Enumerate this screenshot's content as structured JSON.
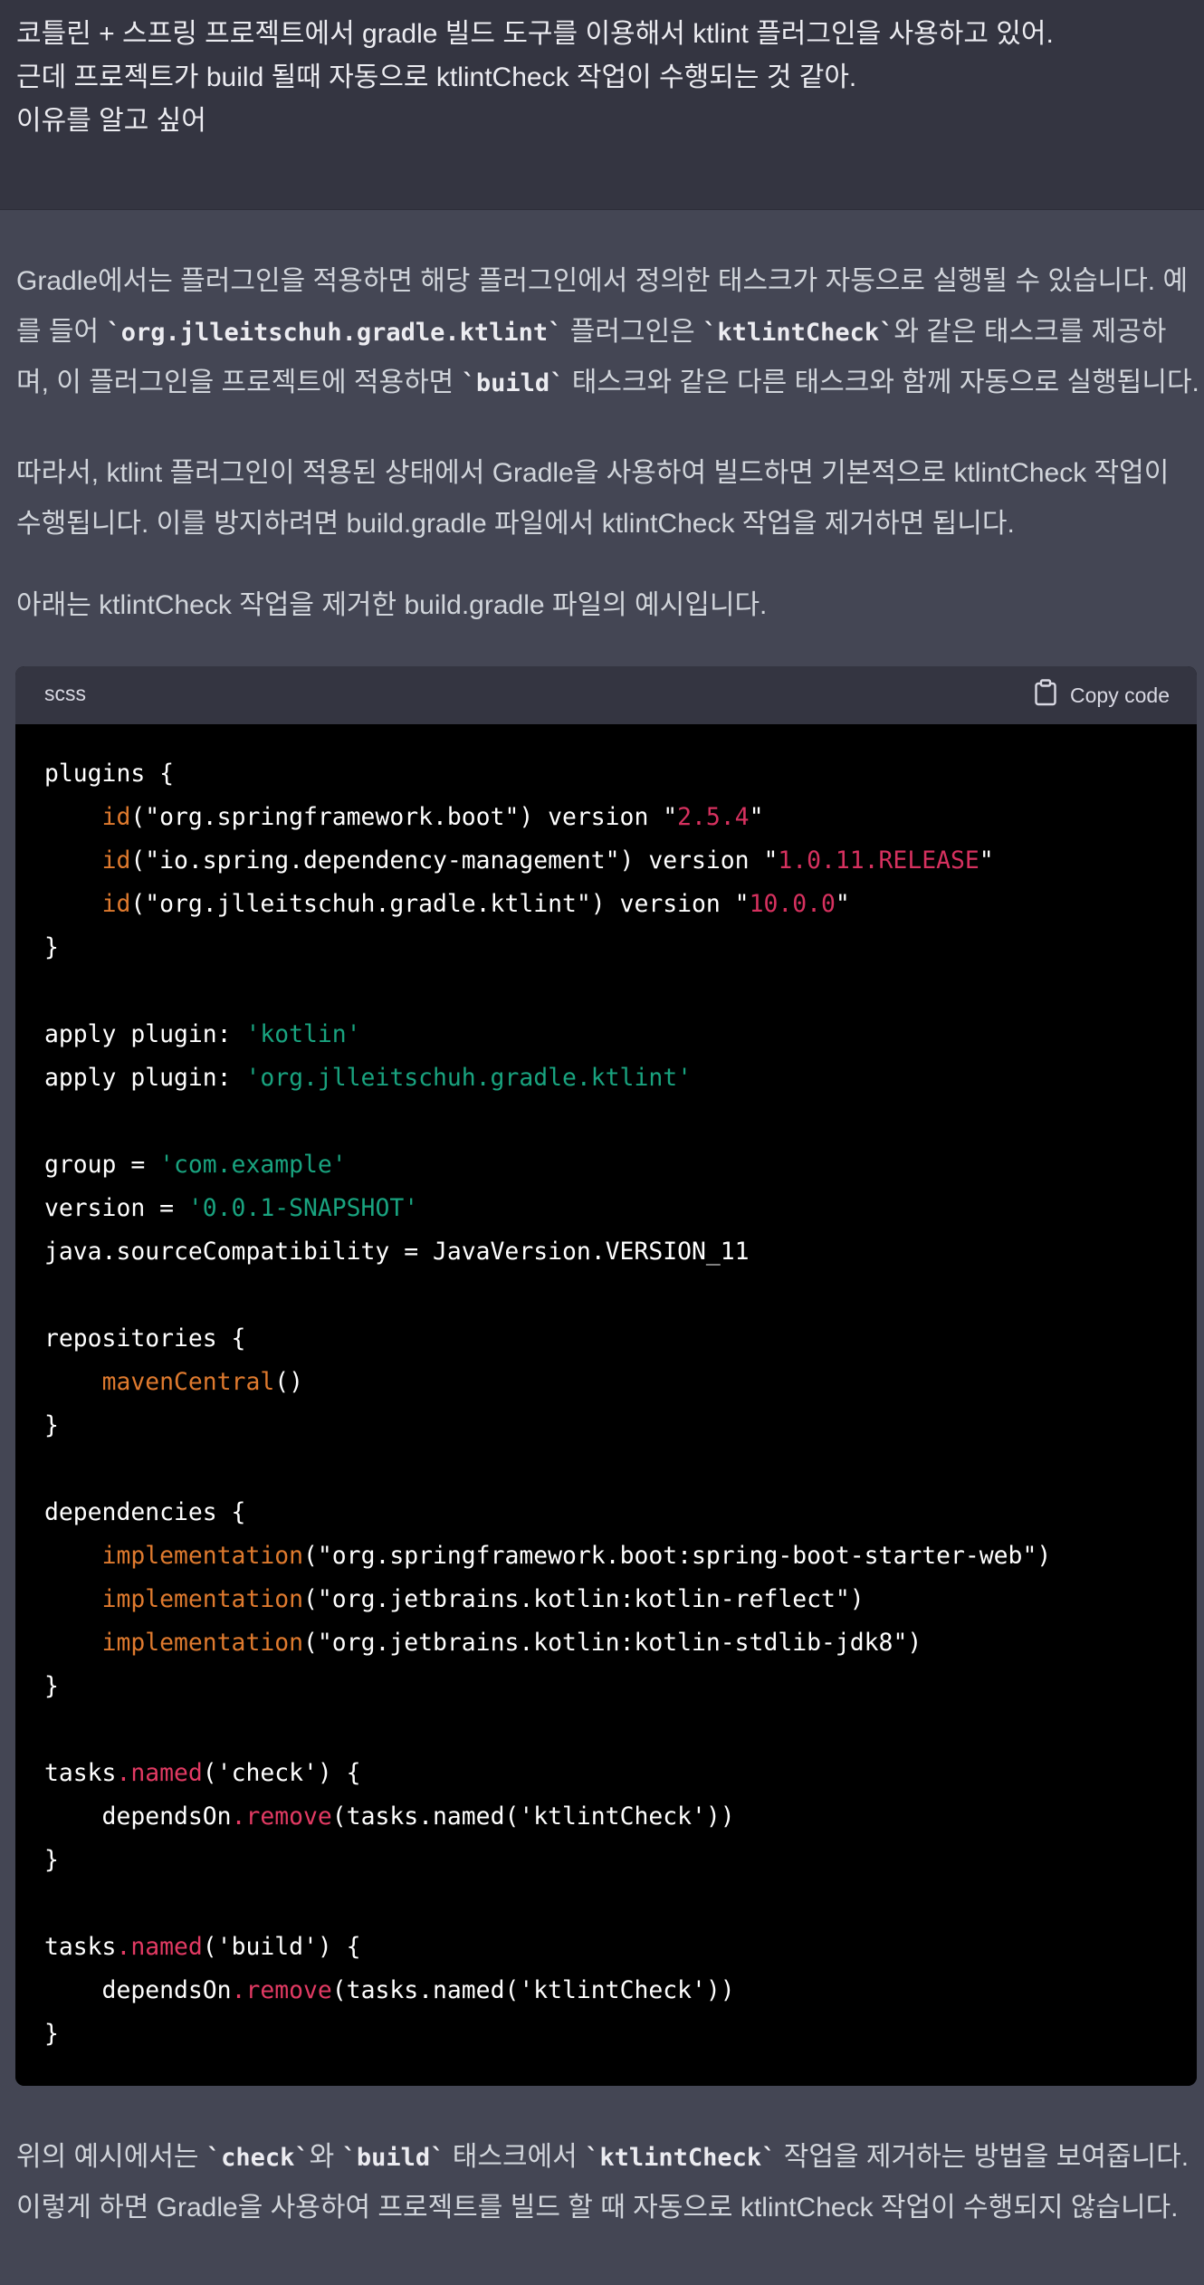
{
  "user_message": {
    "lines": [
      "코틀린 + 스프링 프로젝트에서 gradle 빌드 도구를 이용해서 ktlint 플러그인을 사용하고 있어.",
      "근데 프로젝트가 build 될때 자동으로 ktlintCheck 작업이 수행되는 것 같아.",
      "이유를 알고 싶어"
    ]
  },
  "assistant": {
    "p1": {
      "l1": "Gradle에서는 플러그인을 적용하면 해당 플러그인에서 정의한 태스크가 자동으로 실행될 수 있습니다. 예",
      "l2_a": "를 들어 ",
      "l2_code1": "`org.jlleitschuh.gradle.ktlint`",
      "l2_b": " 플러그인은 ",
      "l2_code2": "`ktlintCheck`",
      "l2_c": "와 같은 태스크를 제공하",
      "l3_a": "며, 이 플러그인을 프로젝트에 적용하면 ",
      "l3_code": "`build`",
      "l3_b": " 태스크와 같은 다른 태스크와 함께 자동으로 실행됩니다."
    },
    "p2": {
      "l1": "따라서, ktlint 플러그인이 적용된 상태에서 Gradle을 사용하여 빌드하면 기본적으로 ktlintCheck 작업이",
      "l2": "수행됩니다. 이를 방지하려면 build.gradle 파일에서 ktlintCheck 작업을 제거하면 됩니다."
    },
    "p3": "아래는 ktlintCheck 작업을 제거한 build.gradle 파일의 예시입니다.",
    "code_block": {
      "language": "scss",
      "copy_label": "Copy code",
      "lines": [
        [
          {
            "t": "plugins {",
            "c": ""
          }
        ],
        [
          {
            "t": "    ",
            "c": ""
          },
          {
            "t": "id",
            "c": "fn"
          },
          {
            "t": "(\"org.springframework.boot\") version \"",
            "c": ""
          },
          {
            "t": "2.5.4",
            "c": "str"
          },
          {
            "t": "\"",
            "c": ""
          }
        ],
        [
          {
            "t": "    ",
            "c": ""
          },
          {
            "t": "id",
            "c": "fn"
          },
          {
            "t": "(\"io.spring.dependency-management\") version \"",
            "c": ""
          },
          {
            "t": "1.0.11.RELEASE",
            "c": "str"
          },
          {
            "t": "\"",
            "c": ""
          }
        ],
        [
          {
            "t": "    ",
            "c": ""
          },
          {
            "t": "id",
            "c": "fn"
          },
          {
            "t": "(\"org.jlleitschuh.gradle.ktlint\") version \"",
            "c": ""
          },
          {
            "t": "10.0.0",
            "c": "str"
          },
          {
            "t": "\"",
            "c": ""
          }
        ],
        [
          {
            "t": "}",
            "c": ""
          }
        ],
        [],
        [
          {
            "t": "apply plugin: ",
            "c": ""
          },
          {
            "t": "'kotlin'",
            "c": "grn"
          }
        ],
        [
          {
            "t": "apply plugin: ",
            "c": ""
          },
          {
            "t": "'org.jlleitschuh.gradle.ktlint'",
            "c": "grn"
          }
        ],
        [],
        [
          {
            "t": "group = ",
            "c": ""
          },
          {
            "t": "'com.example'",
            "c": "grn"
          }
        ],
        [
          {
            "t": "version = ",
            "c": ""
          },
          {
            "t": "'0.0.1-SNAPSHOT'",
            "c": "grn"
          }
        ],
        [
          {
            "t": "java.sourceCompatibility = JavaVersion.VERSION_11",
            "c": ""
          }
        ],
        [],
        [
          {
            "t": "repositories {",
            "c": ""
          }
        ],
        [
          {
            "t": "    ",
            "c": ""
          },
          {
            "t": "mavenCentral",
            "c": "fn"
          },
          {
            "t": "()",
            "c": ""
          }
        ],
        [
          {
            "t": "}",
            "c": ""
          }
        ],
        [],
        [
          {
            "t": "dependencies {",
            "c": ""
          }
        ],
        [
          {
            "t": "    ",
            "c": ""
          },
          {
            "t": "implementation",
            "c": "fn"
          },
          {
            "t": "(\"org.springframework.boot:spring-boot-starter-web\")",
            "c": ""
          }
        ],
        [
          {
            "t": "    ",
            "c": ""
          },
          {
            "t": "implementation",
            "c": "fn"
          },
          {
            "t": "(\"org.jetbrains.kotlin:kotlin-reflect\")",
            "c": ""
          }
        ],
        [
          {
            "t": "    ",
            "c": ""
          },
          {
            "t": "implementation",
            "c": "fn"
          },
          {
            "t": "(\"org.jetbrains.kotlin:kotlin-stdlib-jdk8\")",
            "c": ""
          }
        ],
        [
          {
            "t": "}",
            "c": ""
          }
        ],
        [],
        [
          {
            "t": "tasks",
            "c": ""
          },
          {
            "t": ".named",
            "c": "mth"
          },
          {
            "t": "('check') {",
            "c": ""
          }
        ],
        [
          {
            "t": "    dependsOn",
            "c": ""
          },
          {
            "t": ".remove",
            "c": "mth"
          },
          {
            "t": "(tasks.named('ktlintCheck'))",
            "c": ""
          }
        ],
        [
          {
            "t": "}",
            "c": ""
          }
        ],
        [],
        [
          {
            "t": "tasks",
            "c": ""
          },
          {
            "t": ".named",
            "c": "mth"
          },
          {
            "t": "('build') {",
            "c": ""
          }
        ],
        [
          {
            "t": "    dependsOn",
            "c": ""
          },
          {
            "t": ".remove",
            "c": "mth"
          },
          {
            "t": "(tasks.named('ktlintCheck'))",
            "c": ""
          }
        ],
        [
          {
            "t": "}",
            "c": ""
          }
        ]
      ]
    },
    "p4": {
      "l1_a": "위의 예시에서는 ",
      "l1_code1": "`check`",
      "l1_b": "와 ",
      "l1_code2": "`build`",
      "l1_c": " 태스크에서 ",
      "l1_code3": "`ktlintCheck`",
      "l1_d": " 작업을 제거하는 방법을 보여줍니다.",
      "l2": "이렇게 하면 Gradle을 사용하여 프로젝트를 빌드 할 때 자동으로 ktlintCheck 작업이 수행되지 않습니다."
    }
  },
  "colors": {
    "user_bg": "#343541",
    "assistant_bg": "#444654",
    "code_bg": "#000000",
    "code_header_bg": "#343541",
    "function": "#df7a2e",
    "string": "#d6315f",
    "quote_string": "#19a37f",
    "method": "#e23a63"
  }
}
